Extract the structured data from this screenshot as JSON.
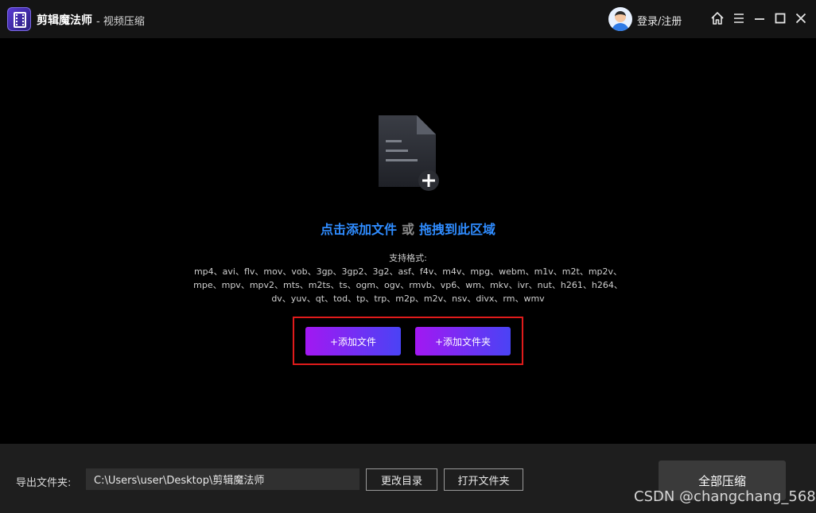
{
  "titlebar": {
    "app_name": "剪辑魔法师",
    "subtitle": "- 视频压缩",
    "login_label": "登录/注册"
  },
  "dropzone": {
    "click_add": "点击添加文件",
    "or": "或",
    "drag_here": "拖拽到此区域",
    "formats_label": "支持格式:",
    "formats_line1": "mp4、avi、flv、mov、vob、3gp、3gp2、3g2、asf、f4v、m4v、mpg、webm、m1v、m2t、mp2v、",
    "formats_line2": "mpe、mpv、mpv2、mts、m2ts、ts、ogm、ogv、rmvb、vp6、wm、mkv、ivr、nut、h261、h264、",
    "formats_line3": "dv、yuv、qt、tod、tp、trp、m2p、m2v、nsv、divx、rm、wmv",
    "add_file_button": "+添加文件",
    "add_folder_button": "+添加文件夹"
  },
  "bottombar": {
    "output_label": "导出文件夹:",
    "output_path": "C:\\Users\\user\\Desktop\\剪辑魔法师",
    "change_dir_button": "更改目录",
    "open_folder_button": "打开文件夹",
    "compress_all_button": "全部压缩"
  },
  "watermark": "CSDN @changchang_568",
  "icons": {
    "home": "home-icon",
    "menu": "menu-icon",
    "minimize": "minimize-icon",
    "maximize": "maximize-icon",
    "close": "close-icon",
    "add_file": "file-add-icon"
  },
  "colors": {
    "accent_blue": "#2f8cff",
    "button_gradient_start": "#a218f2",
    "button_gradient_end": "#4a43f5",
    "highlight_red": "#e01b1b"
  }
}
